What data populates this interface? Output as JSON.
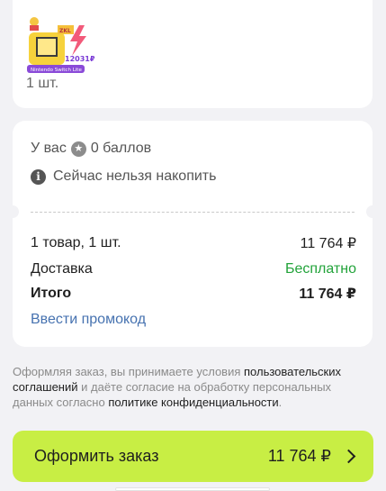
{
  "product": {
    "quantity": "1 шт.",
    "badge_price_text": "12031₽",
    "badge_label": "Nintendo Switch Lite"
  },
  "points": {
    "prefix": "У вас",
    "value": "0 баллов",
    "info": "Сейчас нельзя накопить"
  },
  "summary": {
    "items_label": "1 товар, 1 шт.",
    "items_value": "11 764 ₽",
    "delivery_label": "Доставка",
    "delivery_value": "Бесплатно",
    "total_label": "Итого",
    "total_value": "11 764 ₽",
    "promo_link": "Ввести промокод"
  },
  "legal": {
    "part1": "Оформляя заказ, вы принимаете условия ",
    "link1": "пользовательских соглашений",
    "part2": " и даёте согласие на обработку персональных данных согласно ",
    "link2": "политике конфиденциальности",
    "part3": "."
  },
  "checkout": {
    "label": "Оформить заказ",
    "price": "11 764 ₽"
  },
  "colors": {
    "accent_button": "#c8ee44",
    "link": "#4672b0",
    "free_delivery": "#22a33a",
    "background": "#f2f2f5"
  }
}
